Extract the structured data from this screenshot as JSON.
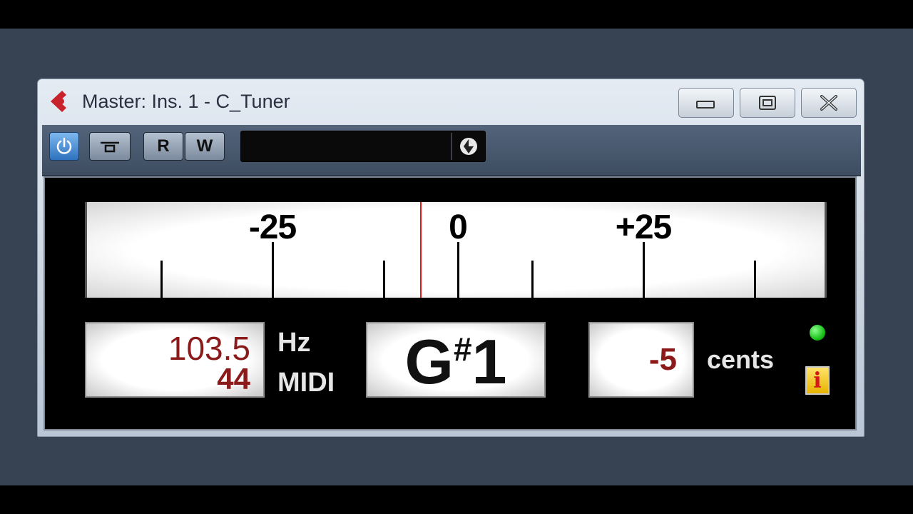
{
  "window": {
    "title": "Master: Ins. 1 - C_Tuner"
  },
  "toolbar": {
    "read_label": "R",
    "write_label": "W"
  },
  "tuner": {
    "scale_labels": [
      "-25",
      "0",
      "+25"
    ],
    "scale_range_cents": [
      -50,
      50
    ],
    "tick_positions_cents": [
      -40,
      -25,
      -10,
      0,
      10,
      25,
      40
    ],
    "needle_cents": -5,
    "frequency": "103.5",
    "frequency_unit": "Hz",
    "midi_note": "44",
    "midi_unit": "MIDI",
    "note": {
      "letter": "G",
      "accidental": "#",
      "octave": "1"
    },
    "cents": "-5",
    "cents_unit": "cents",
    "info_label": "i"
  },
  "colors": {
    "readout_text": "#8b1a1a",
    "needle": "#e01818",
    "status_led": "#1cc31c",
    "power_active": "#2f72bd"
  },
  "icons": {
    "logo": "cubase-logo-icon",
    "power": "power-icon",
    "bypass": "bypass-icon",
    "preset": "preset-browser-icon"
  }
}
